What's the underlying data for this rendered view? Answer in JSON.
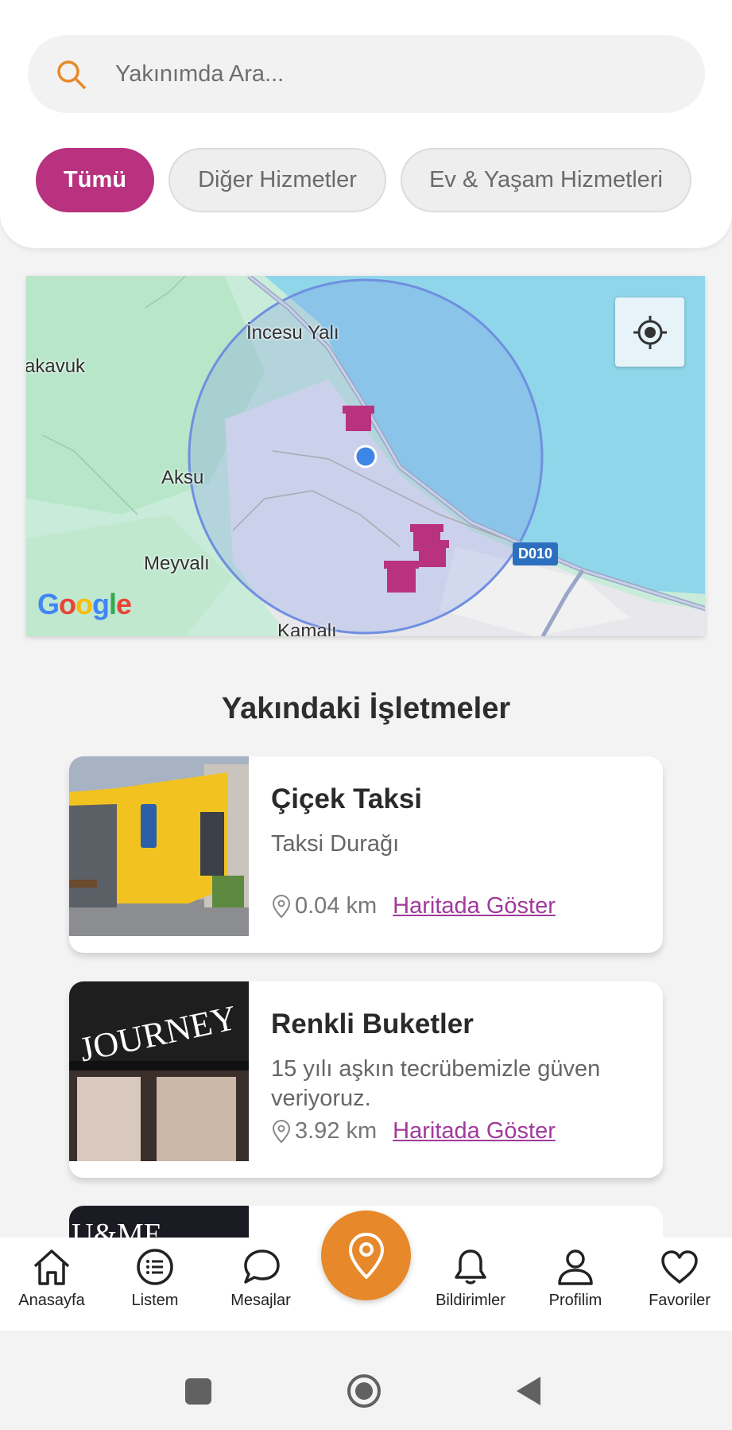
{
  "search": {
    "placeholder": "Yakınımda Ara..."
  },
  "chips": [
    {
      "label": "Tümü",
      "active": true
    },
    {
      "label": "Diğer Hizmetler",
      "active": false
    },
    {
      "label": "Ev & Yaşam Hizmetleri",
      "active": false
    }
  ],
  "map": {
    "labels": [
      "İncesu Yalı",
      "akavuk",
      "Aksu",
      "Meyvalı",
      "Kamalı"
    ],
    "road_badge": "D010",
    "google_logo": "Google"
  },
  "section_title": "Yakındaki İşletmeler",
  "businesses": [
    {
      "name": "Çiçek Taksi",
      "description": "Taksi Durağı",
      "distance": "0.04 km",
      "link": "Haritada Göster"
    },
    {
      "name": "Renkli Buketler",
      "description": "15 yılı aşkın tecrübemizle güven veriyoruz.",
      "distance": "3.92 km",
      "link": "Haritada Göster"
    }
  ],
  "third_card_sign": "U&ME",
  "nav": [
    {
      "label": "Anasayfa",
      "icon": "home-icon"
    },
    {
      "label": "Listem",
      "icon": "list-icon"
    },
    {
      "label": "Mesajlar",
      "icon": "chat-icon"
    },
    {
      "label": "Bildirimler",
      "icon": "bell-icon"
    },
    {
      "label": "Profilim",
      "icon": "profile-icon"
    },
    {
      "label": "Favoriler",
      "icon": "heart-icon"
    }
  ],
  "colors": {
    "accent": "#b8327f",
    "fab": "#e7892a",
    "link": "#a03a9b",
    "search_icon": "#e7892a"
  }
}
